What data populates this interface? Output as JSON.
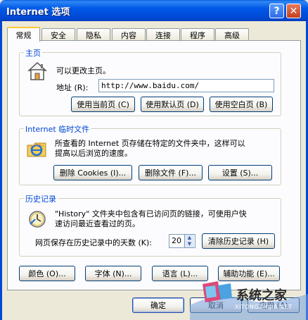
{
  "window": {
    "title": "Internet 选项",
    "help_label": "?",
    "close_label": "✕"
  },
  "tabs": [
    {
      "label": "常规",
      "active": true
    },
    {
      "label": "安全"
    },
    {
      "label": "隐私"
    },
    {
      "label": "内容"
    },
    {
      "label": "连接"
    },
    {
      "label": "程序"
    },
    {
      "label": "高级"
    }
  ],
  "home": {
    "legend": "主页",
    "description": "可以更改主页。",
    "address_label": "地址 (R):",
    "address_value": "http://www.baidu.com/",
    "use_current": "使用当前页 (C)",
    "use_default": "使用默认页 (D)",
    "use_blank": "使用空白页 (B)"
  },
  "temp_files": {
    "legend": "Internet 临时文件",
    "description_line1": "所查看的 Internet 页存储在特定的文件夹中，这样可以",
    "description_line2": "提高以后浏览的速度。",
    "delete_cookies": "删除 Cookies (I)...",
    "delete_files": "删除文件 (F)...",
    "settings": "设置 (S)..."
  },
  "history": {
    "legend": "历史记录",
    "description_line1": "\"History\" 文件夹中包含有已访问页的链接，可使用户快",
    "description_line2": "速访问最近查看过的页。",
    "days_label": "网页保存在历史记录中的天数 (K):",
    "days_value": "20",
    "clear": "清除历史记录 (H)"
  },
  "bottom_buttons": {
    "colors": "颜色 (O)...",
    "fonts": "字体 (N)...",
    "languages": "语言 (L)...",
    "accessibility": "辅助功能 (E)..."
  },
  "dialog_buttons": {
    "ok": "确定",
    "cancel": "取消",
    "apply": "应用 (A)"
  },
  "watermark": {
    "name": "系统之家",
    "url": "XITONGZHIJIA.NET"
  }
}
